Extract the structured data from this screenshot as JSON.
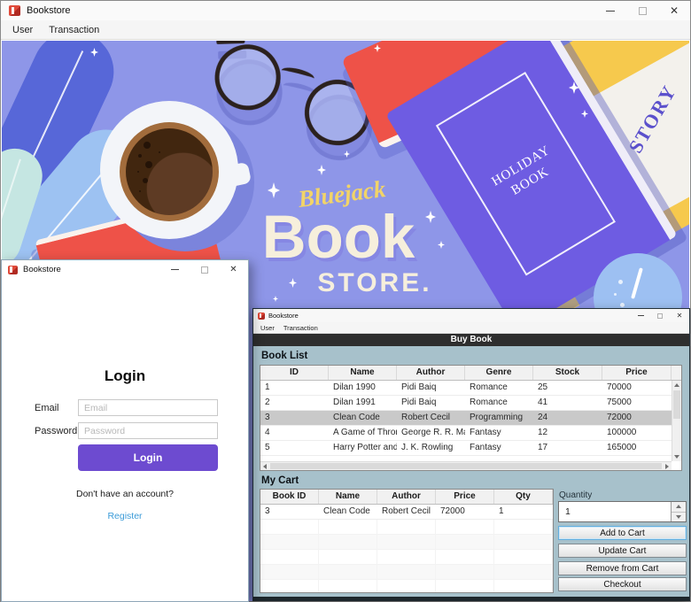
{
  "icons": {
    "close": "✕"
  },
  "main_window": {
    "title": "Bookstore",
    "menu": [
      "User",
      "Transaction"
    ]
  },
  "banner": {
    "script_text": "Bluejack",
    "title_text": "Book",
    "subtitle_text": "STORE.",
    "holiday_line1": "HOLIDAY",
    "holiday_line2": "BOOK",
    "story_text": "STORY",
    "colors": {
      "background": "#8e96e8",
      "purple_book": "#6e5ce2",
      "yellow_book": "#f6c94d",
      "red_book": "#ee5248",
      "script_accent": "#f2d468",
      "brand_text": "#f6efdc"
    }
  },
  "login_window": {
    "title": "Bookstore",
    "heading": "Login",
    "email_label": "Email",
    "email_placeholder": "Email",
    "password_label": "Password",
    "password_placeholder": "Password",
    "login_button_label": "Login",
    "no_account_text": "Don't have an account?",
    "register_link_label": "Register",
    "accent_color": "#6d4bd0",
    "link_color": "#3b9bd8"
  },
  "buy_book_window": {
    "title": "Bookstore",
    "menu": [
      "User",
      "Transaction"
    ],
    "header_title": "Buy Book",
    "book_list": {
      "section_label": "Book List",
      "columns": [
        "ID",
        "Name",
        "Author",
        "Genre",
        "Stock",
        "Price"
      ],
      "rows": [
        [
          "1",
          "Dilan 1990",
          "Pidi Baiq",
          "Romance",
          "25",
          "70000"
        ],
        [
          "2",
          "Dilan 1991",
          "Pidi Baiq",
          "Romance",
          "41",
          "75000"
        ],
        [
          "3",
          "Clean Code",
          "Robert Cecil",
          "Programming",
          "24",
          "72000"
        ],
        [
          "4",
          "A Game of Thron...",
          "George R. R. Mar...",
          "Fantasy",
          "12",
          "100000"
        ],
        [
          "5",
          "Harry Potter and ...",
          "J. K. Rowling",
          "Fantasy",
          "17",
          "165000"
        ]
      ],
      "selected_row_index": 2
    },
    "cart": {
      "section_label": "My Cart",
      "columns": [
        "Book ID",
        "Name",
        "Author",
        "Price",
        "Qty"
      ],
      "rows": [
        [
          "3",
          "Clean Code",
          "Robert Cecil",
          "72000",
          "1"
        ]
      ]
    },
    "quantity_label": "Quantity",
    "quantity_value": "1",
    "action_buttons": [
      "Add to Cart",
      "Update Cart",
      "Remove from Cart",
      "Checkout"
    ]
  }
}
